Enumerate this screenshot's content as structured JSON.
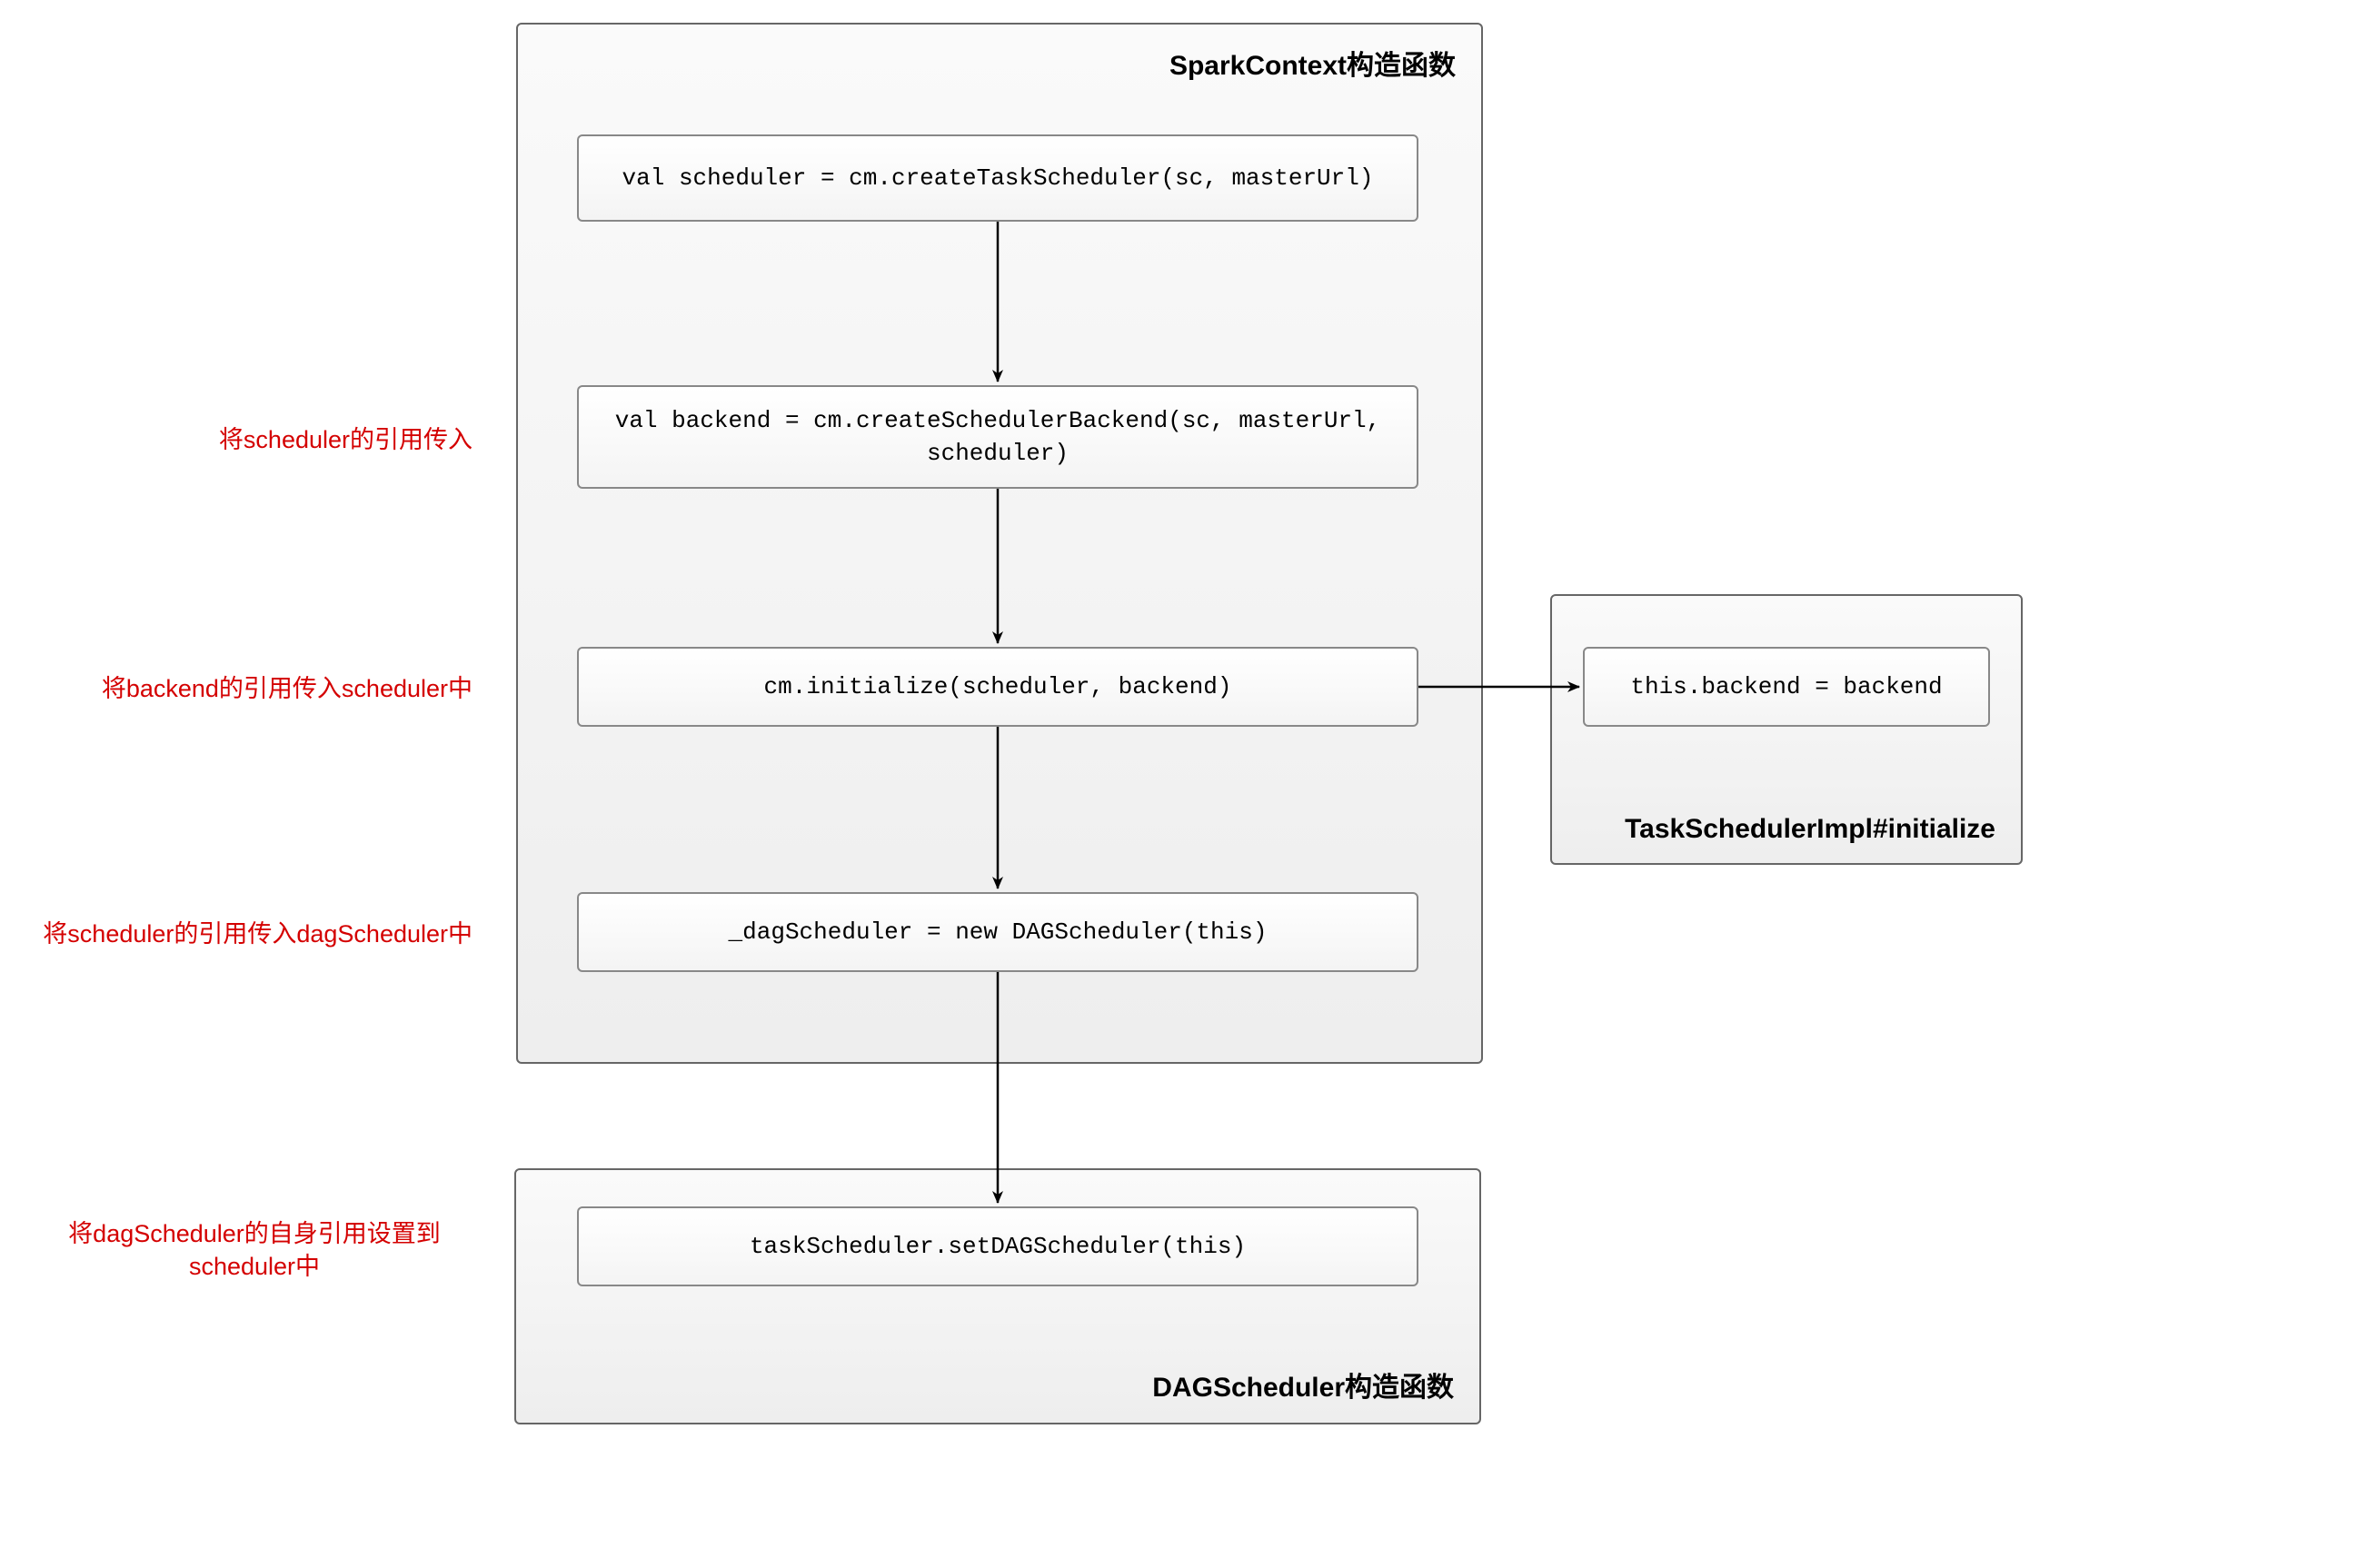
{
  "containers": {
    "spark_context": {
      "title": "SparkContext构造函数"
    },
    "task_scheduler_impl": {
      "title": "TaskSchedulerImpl#initialize"
    },
    "dag_scheduler": {
      "title": "DAGScheduler构造函数"
    }
  },
  "boxes": {
    "create_task_scheduler": "val scheduler = cm.createTaskScheduler(sc, masterUrl)",
    "create_backend": "val backend = cm.createSchedulerBackend(sc, masterUrl, scheduler)",
    "initialize": "cm.initialize(scheduler, backend)",
    "dag_new": "_dagScheduler = new DAGScheduler(this)",
    "backend_assign": "this.backend = backend",
    "set_dag": "taskScheduler.setDAGScheduler(this)"
  },
  "annotations": {
    "a1": "将scheduler的引用传入",
    "a2": "将backend的引用传入scheduler中",
    "a3": "将scheduler的引用传入dagScheduler中",
    "a4_line1": "将dagScheduler的自身引用设置到",
    "a4_line2": "scheduler中"
  }
}
